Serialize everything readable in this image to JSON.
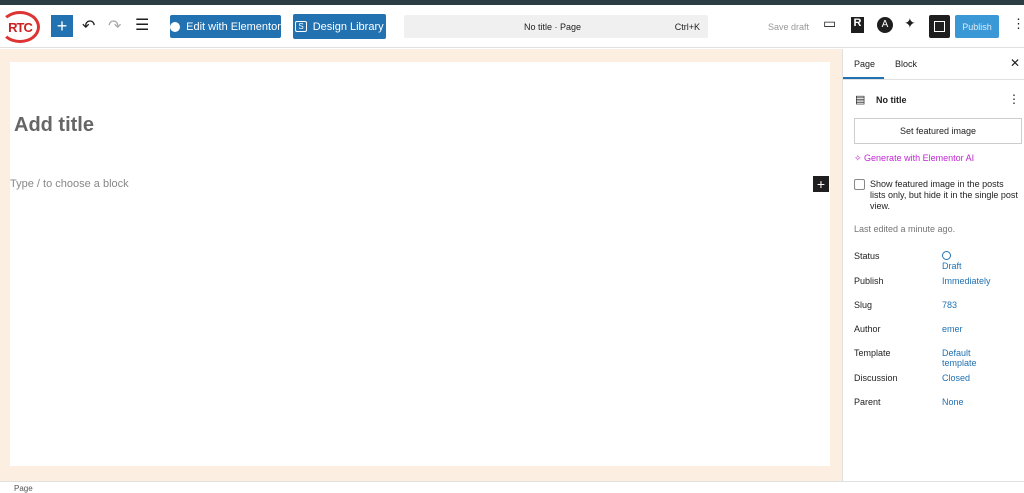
{
  "toolbar": {
    "logo_text": "RTC",
    "edit_elementor": "Edit with Elementor",
    "design_library": "Design Library",
    "command_title": "No title · Page",
    "shortcut": "Ctrl+K",
    "save_draft": "Save draft",
    "publish": "Publish"
  },
  "editor": {
    "title_placeholder": "Add title",
    "block_placeholder": "Type / to choose a block"
  },
  "sidebar": {
    "tabs": [
      {
        "label": "Page",
        "active": true
      },
      {
        "label": "Block",
        "active": false
      }
    ],
    "doc_title": "No title",
    "featured_button": "Set featured image",
    "generate_ai": "Generate with Elementor AI",
    "checkbox_label": "Show featured image in the posts lists only, but hide it in the single post view.",
    "checkbox_checked": false,
    "last_edited": "Last edited a minute ago.",
    "fields": [
      {
        "label": "Status",
        "value": "Draft"
      },
      {
        "label": "Publish",
        "value": "Immediately"
      },
      {
        "label": "Slug",
        "value": "783"
      },
      {
        "label": "Author",
        "value": "emer"
      },
      {
        "label": "Template",
        "value": "Default template"
      },
      {
        "label": "Discussion",
        "value": "Closed"
      },
      {
        "label": "Parent",
        "value": "None"
      }
    ]
  },
  "footer": {
    "breadcrumb": "Page"
  },
  "colors": {
    "accent": "#2271b1",
    "canvas_bg": "#fdeee2",
    "ai": "#c026d3"
  }
}
